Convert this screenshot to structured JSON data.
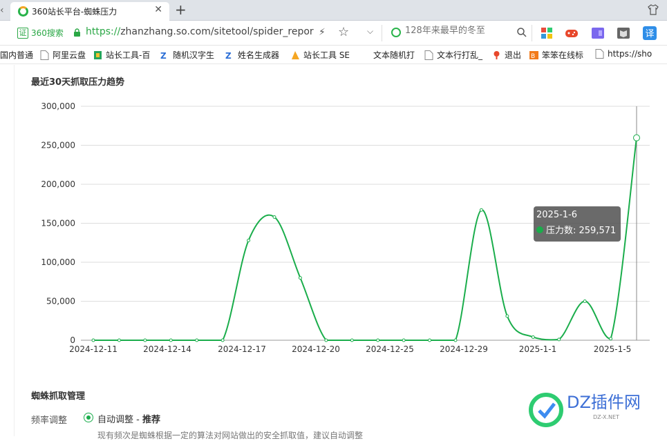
{
  "browser": {
    "tab_title": "360站长平台-蜘蛛压力",
    "url_scheme": "https://",
    "url_rest": "zhanzhang.so.com/sitetool/spider_report",
    "cert_label": "360搜索",
    "cert_badge": "证",
    "search_placeholder": "128年来最早的冬至"
  },
  "bookmarks": [
    {
      "label": "国内普通",
      "icon": "bookmark-icon"
    },
    {
      "label": "阿里云盘",
      "icon": "page-icon"
    },
    {
      "label": "站长工具-百",
      "icon": "tool-icon"
    },
    {
      "label": "随机汉字生",
      "icon": "zj-icon"
    },
    {
      "label": "姓名生成器",
      "icon": "zj-icon"
    },
    {
      "label": "站长工具 SE",
      "icon": "tool-icon"
    },
    {
      "label": "文本随机打",
      "icon": "none"
    },
    {
      "label": "文本行打乱_",
      "icon": "page-icon"
    },
    {
      "label": "退出",
      "icon": "pin-icon"
    },
    {
      "label": "笨笨在线标",
      "icon": "bb-icon"
    },
    {
      "label": "https://sho",
      "icon": "page-icon"
    }
  ],
  "chart_section": {
    "title": "最近30天抓取压力趋势"
  },
  "chart_data": {
    "type": "line",
    "title": "最近30天抓取压力趋势",
    "xlabel": "",
    "ylabel": "",
    "ylim": [
      0,
      300000
    ],
    "y_ticks": [
      "300,000",
      "250,000",
      "200,000",
      "150,000",
      "100,000",
      "50,000",
      "0"
    ],
    "x_ticks": [
      "2024-12-11",
      "2024-12-14",
      "2024-12-17",
      "2024-12-20",
      "2024-12-25",
      "2024-12-29",
      "2025-1-1",
      "2025-1-5"
    ],
    "series": [
      {
        "name": "压力数",
        "color": "#1aad4b",
        "values": [
          0,
          0,
          0,
          0,
          0,
          0,
          128000,
          158000,
          80000,
          0,
          0,
          0,
          0,
          0,
          0,
          167000,
          31000,
          4000,
          1000,
          50000,
          2000,
          259571
        ]
      }
    ],
    "grid": true,
    "tooltip": {
      "date": "2025-1-6",
      "label": "压力数",
      "value": "259,571"
    }
  },
  "tooltip": {
    "date": "2025-1-6",
    "row": "压力数: 259,571"
  },
  "spider_section": {
    "title": "蜘蛛抓取管理",
    "freq_label": "频率调整",
    "auto_label": "自动调整 - ",
    "auto_recommend": "推荐",
    "desc": "现有频次是蜘蛛根据一定的算法对网站做出的安全抓取值，建议自动调整"
  },
  "watermark": {
    "text": "DZ插件网",
    "sub": "DZ-X.NET"
  }
}
